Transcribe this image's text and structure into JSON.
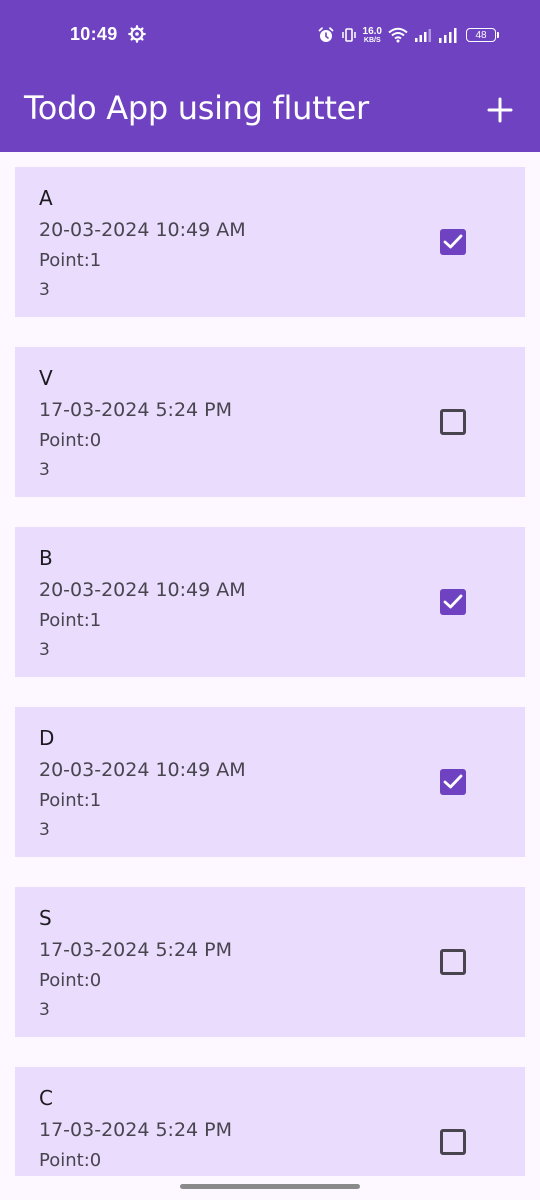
{
  "status_bar": {
    "time": "10:49",
    "net_speed_value": "16.0",
    "net_speed_unit": "KB/S",
    "battery": "48"
  },
  "app_bar": {
    "title": "Todo App using flutter",
    "add_icon": "plus-icon"
  },
  "colors": {
    "primary": "#6f42c1",
    "card_background": "#e9dcfd",
    "page_background": "#fdf7ff"
  },
  "todos": [
    {
      "title": "A",
      "date": "20-03-2024 10:49 AM",
      "point": "Point:1",
      "extra": "3",
      "checked": true
    },
    {
      "title": "V",
      "date": "17-03-2024 5:24 PM",
      "point": "Point:0",
      "extra": "3",
      "checked": false
    },
    {
      "title": "B",
      "date": "20-03-2024 10:49 AM",
      "point": "Point:1",
      "extra": "3",
      "checked": true
    },
    {
      "title": "D",
      "date": "20-03-2024 10:49 AM",
      "point": "Point:1",
      "extra": "3",
      "checked": true
    },
    {
      "title": "S",
      "date": "17-03-2024 5:24 PM",
      "point": "Point:0",
      "extra": "3",
      "checked": false
    },
    {
      "title": "C",
      "date": "17-03-2024 5:24 PM",
      "point": "Point:0",
      "extra": "",
      "checked": false
    }
  ]
}
